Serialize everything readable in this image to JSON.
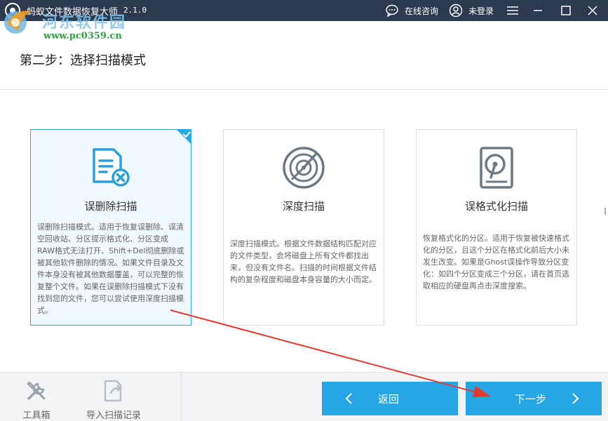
{
  "window": {
    "title": "蚂蚁文件数据恢复大师",
    "version": "2.1.0",
    "consult_label": "在线咨询",
    "login_label": "未登录"
  },
  "watermark": {
    "name": "河东软件园",
    "url": "www.pc0359.cn"
  },
  "step": {
    "title": "第二步：选择扫描模式"
  },
  "modes": [
    {
      "title": "误删除扫描",
      "icon": "deleted-file-icon",
      "selected": true,
      "description": "误删除扫描模式。适用于恢复误删除、误清空回收站、分区提示格式化、分区变成RAW格式无法打开、Shift+Del彻底删除或被其他软件删除的情况。如果文件目录及文件本身没有被其他数据覆盖，可以完整的恢复整个文件。如果在误删除扫描模式下没有找到您的文件，您可以尝试使用深度扫描模式。"
    },
    {
      "title": "深度扫描",
      "icon": "radar-scan-icon",
      "selected": false,
      "description": "深度扫描模式。根据文件数据结构匹配对应的文件类型，会将磁盘上所有文件都找出来，但没有文件名。扫描的时间根据文件结构的复杂程度和磁盘本身容量的大小而定。"
    },
    {
      "title": "误格式化扫描",
      "icon": "hard-disk-icon",
      "selected": false,
      "description": "恢复格式化的分区。适用于恢复被快速格式化的分区，且这个分区在格式化前后大小未发生改变。如果是Ghost误操作导致分区变化：如四个分区变成三个分区，请在首页选取相应的硬盘再点击深度搜索。"
    }
  ],
  "footer": {
    "toolbox_label": "工具箱",
    "import_label": "导入扫描记录",
    "back_label": "返回",
    "next_label": "下一步"
  },
  "colors": {
    "titlebar": "#2b3a4e",
    "accent": "#26a6e5",
    "selected_border": "#28a8e8",
    "annotation_arrow": "#e53a2f"
  }
}
